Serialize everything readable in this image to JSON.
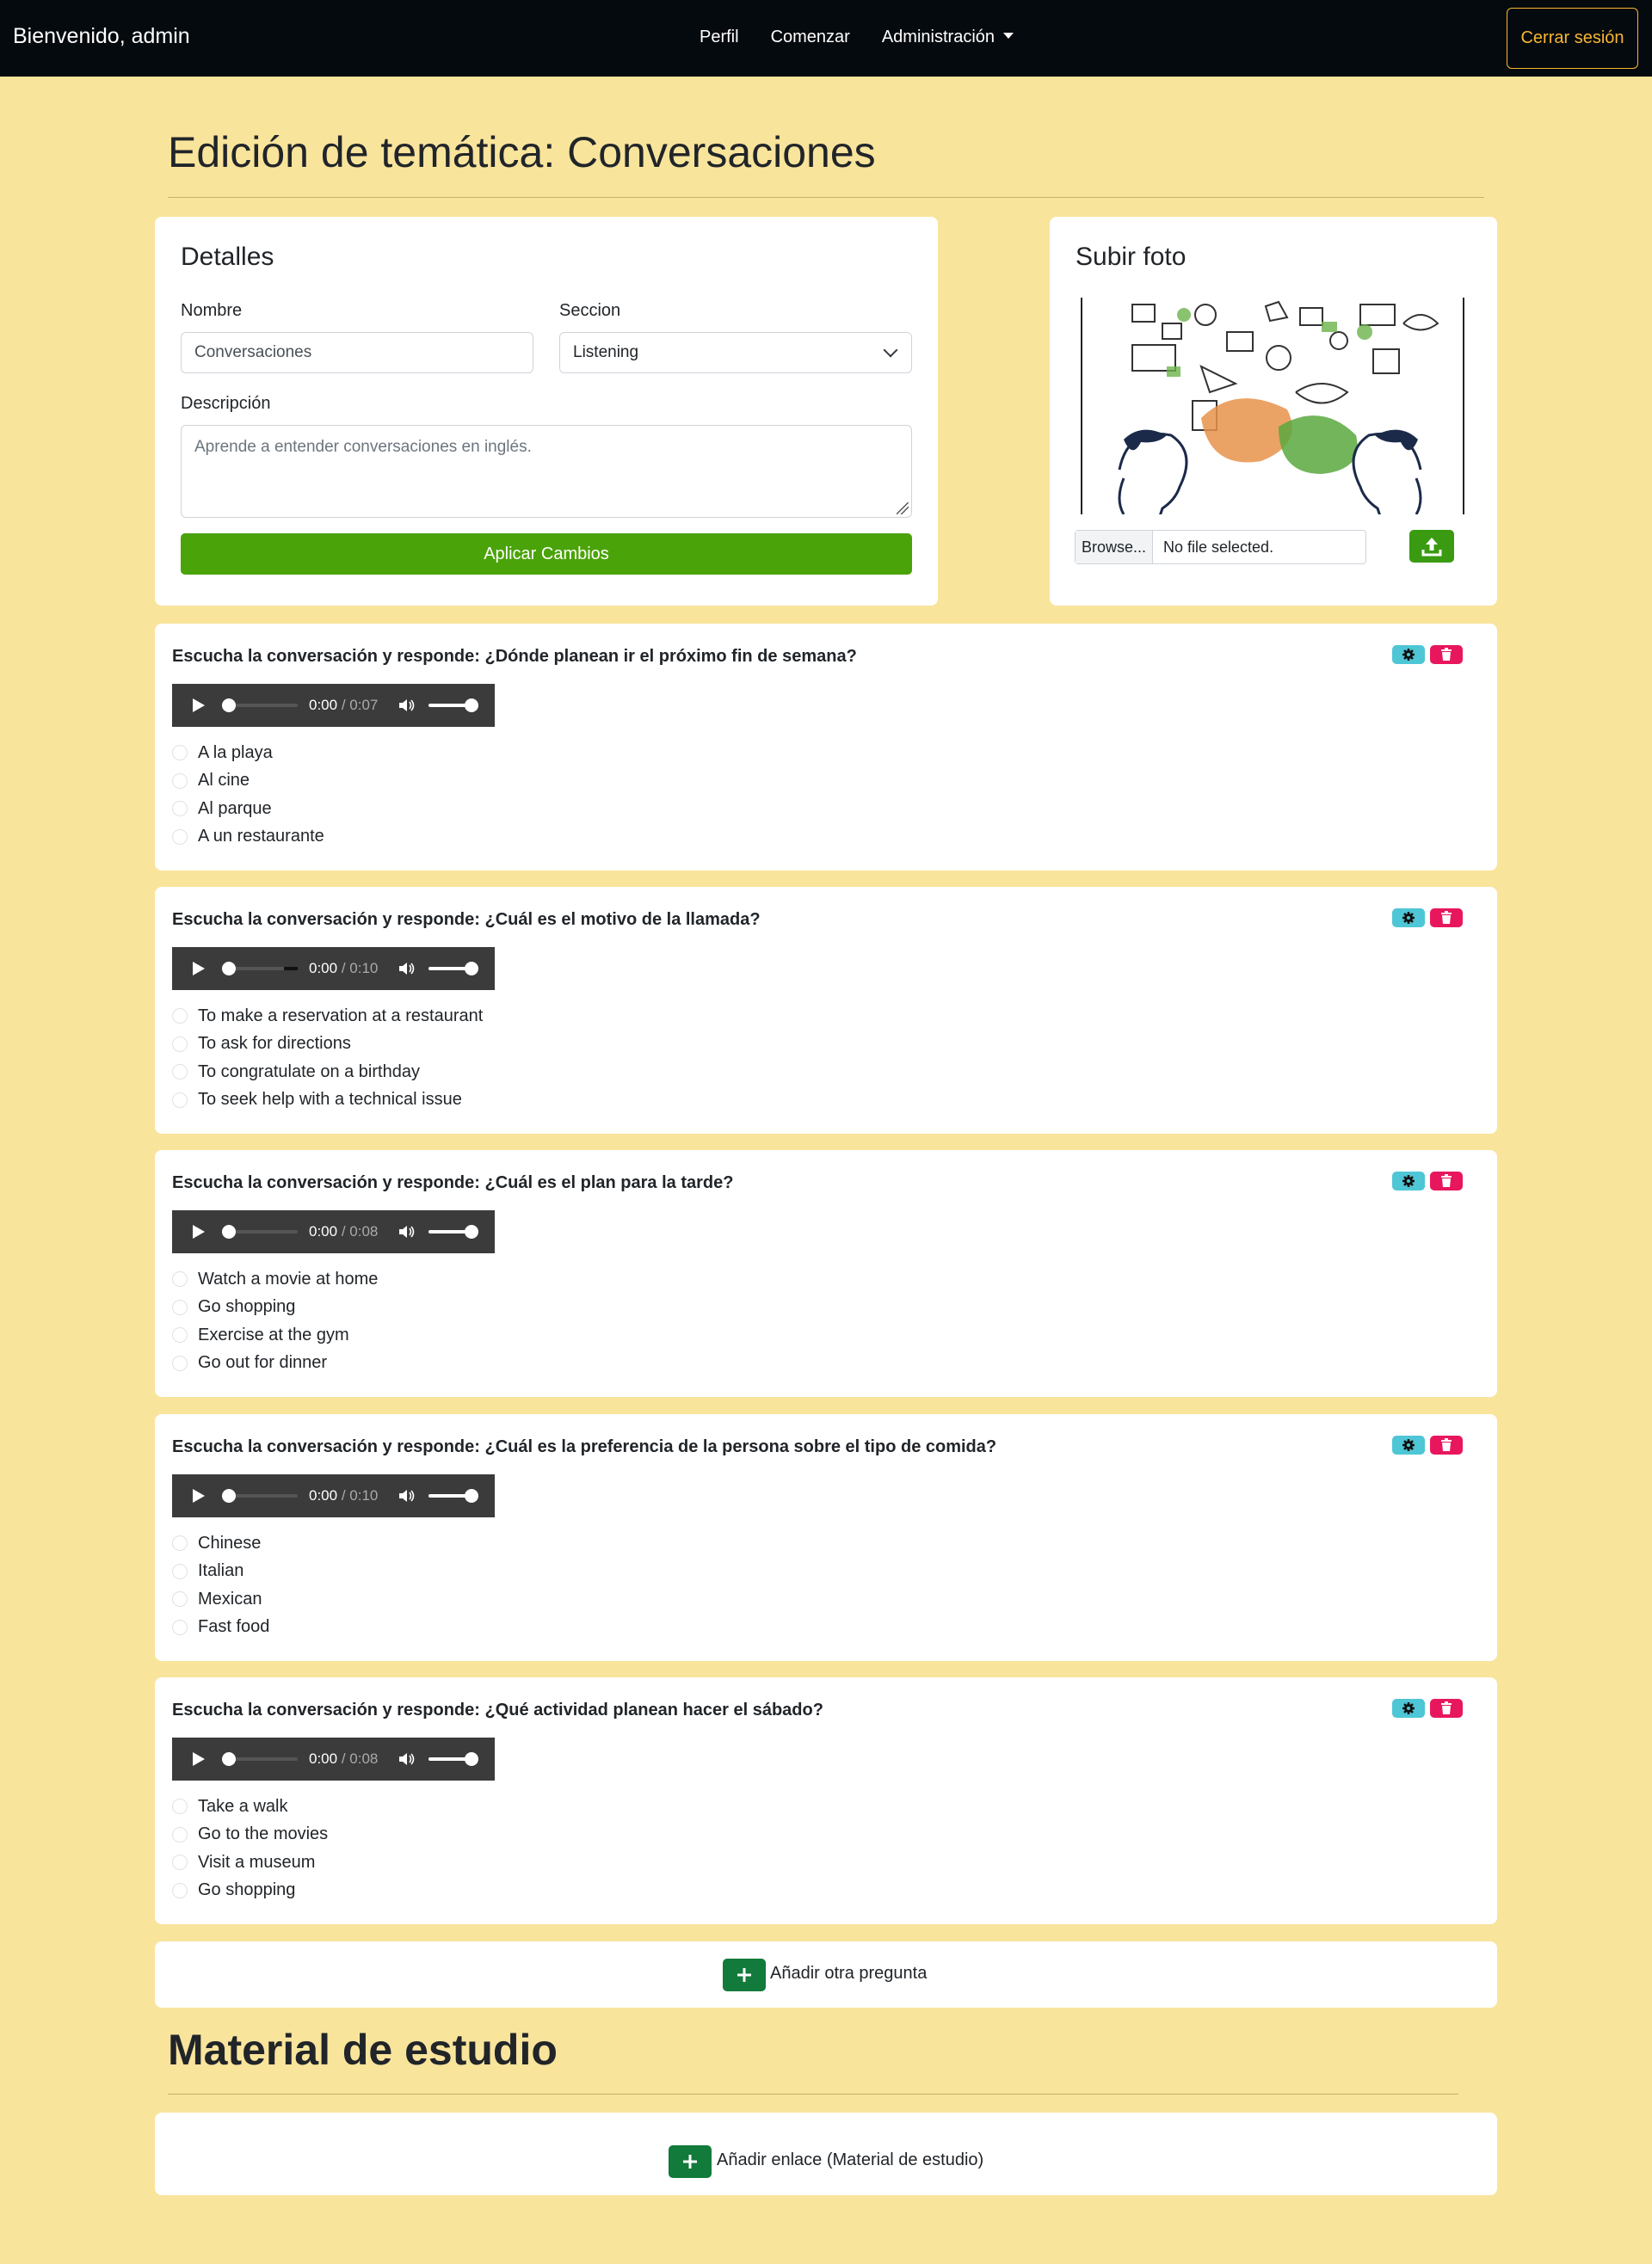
{
  "navbar": {
    "welcome": "Bienvenido, admin",
    "links": [
      "Perfil",
      "Comenzar",
      "Administración"
    ],
    "logout": "Cerrar sesión"
  },
  "page": {
    "title": "Edición de temática: Conversaciones"
  },
  "details": {
    "title": "Detalles",
    "name_label": "Nombre",
    "name_value": "Conversaciones",
    "section_label": "Seccion",
    "section_value": "Listening",
    "description_label": "Descripción",
    "description_placeholder": "Aprende a entender conversaciones en inglés.",
    "apply_button": "Aplicar Cambios"
  },
  "photo": {
    "title": "Subir foto",
    "browse_button": "Browse...",
    "file_status": "No file selected."
  },
  "questions": [
    {
      "title": "Escucha la conversación y responde: ¿Dónde planean ir el próximo fin de semana?",
      "current_time": "0:00",
      "duration": "/ 0:07",
      "options": [
        "A la playa",
        "Al cine",
        "Al parque",
        "A un restaurante"
      ]
    },
    {
      "title": "Escucha la conversación y responde: ¿Cuál es el motivo de la llamada?",
      "current_time": "0:00",
      "duration": "/ 0:10",
      "options": [
        "To make a reservation at a restaurant",
        "To ask for directions",
        "To congratulate on a birthday",
        "To seek help with a technical issue"
      ]
    },
    {
      "title": "Escucha la conversación y responde: ¿Cuál es el plan para la tarde?",
      "current_time": "0:00",
      "duration": "/ 0:08",
      "options": [
        "Watch a movie at home",
        "Go shopping",
        "Exercise at the gym",
        "Go out for dinner"
      ]
    },
    {
      "title": "Escucha la conversación y responde: ¿Cuál es la preferencia de la persona sobre el tipo de comida?",
      "current_time": "0:00",
      "duration": "/ 0:10",
      "options": [
        "Chinese",
        "Italian",
        "Mexican",
        "Fast food"
      ]
    },
    {
      "title": "Escucha la conversación y responde: ¿Qué actividad planean hacer el sábado?",
      "current_time": "0:00",
      "duration": "/ 0:08",
      "options": [
        "Take a walk",
        "Go to the movies",
        "Visit a museum",
        "Go shopping"
      ]
    }
  ],
  "add_question": "Añadir otra pregunta",
  "study": {
    "title": "Material de estudio",
    "add_link": "Añadir enlace (Material de estudio)"
  },
  "colors": {
    "background": "#f9e49c",
    "navbar": "#050a0e",
    "accent_orange": "#f7b733",
    "apply_green": "#4aa308",
    "add_green": "#127a3a",
    "gear_cyan": "#4ec6d6",
    "trash_pink": "#e8175d"
  }
}
